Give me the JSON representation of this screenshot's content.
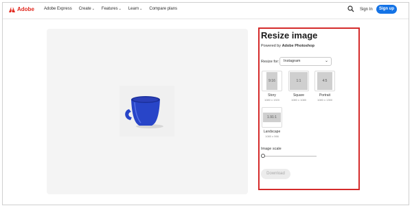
{
  "nav": {
    "brand": "Adobe",
    "links": [
      {
        "label": "Adobe Express",
        "has_caret": false
      },
      {
        "label": "Create",
        "has_caret": true
      },
      {
        "label": "Features",
        "has_caret": true
      },
      {
        "label": "Learn",
        "has_caret": true
      },
      {
        "label": "Compare plans",
        "has_caret": false
      }
    ],
    "caret": "⌄",
    "sign_in": "Sign In",
    "sign_up": "Sign up",
    "search_icon": "search-icon"
  },
  "panel": {
    "title": "Resize image",
    "powered_prefix": "Powered by ",
    "powered_brand": "Adobe Photoshop",
    "resize_for_label": "Resize for:",
    "resize_for_value": "Instagram",
    "options": [
      {
        "ratio": "9:16",
        "name": "Story",
        "size": "1080 x 1920"
      },
      {
        "ratio": "1:1",
        "name": "Square",
        "size": "1080 x 1080"
      },
      {
        "ratio": "4:5",
        "name": "Portrait",
        "size": "1080 x 1350"
      },
      {
        "ratio": "1.91:1",
        "name": "Landscape",
        "size": "1080 x 566"
      }
    ],
    "scale_label": "Image scale",
    "download_label": "Download"
  },
  "colors": {
    "brand_red": "#e1251b",
    "primary_blue": "#1473e6",
    "highlight_red": "#d42a2a",
    "cup_blue": "#2845c8"
  }
}
